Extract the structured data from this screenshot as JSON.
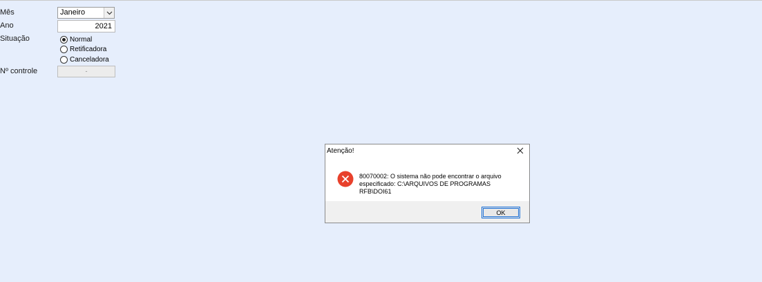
{
  "form": {
    "month_label": "Mês",
    "month_value": "Janeiro",
    "year_label": "Ano",
    "year_value": "2021",
    "situation_label": "Situação",
    "situation_options": [
      {
        "label": "Normal",
        "checked": true
      },
      {
        "label": "Retificadora",
        "checked": false
      },
      {
        "label": "Canceladora",
        "checked": false
      }
    ],
    "control_label": "Nº controle",
    "control_value": "-"
  },
  "dialog": {
    "title": "Atenção!",
    "message": "80070002: O sistema não pode encontrar o arquivo especificado: C:\\ARQUIVOS DE PROGRAMAS RFB\\DOI61",
    "ok_label": "OK",
    "icon": "error-icon",
    "icon_color": "#e8412c"
  }
}
